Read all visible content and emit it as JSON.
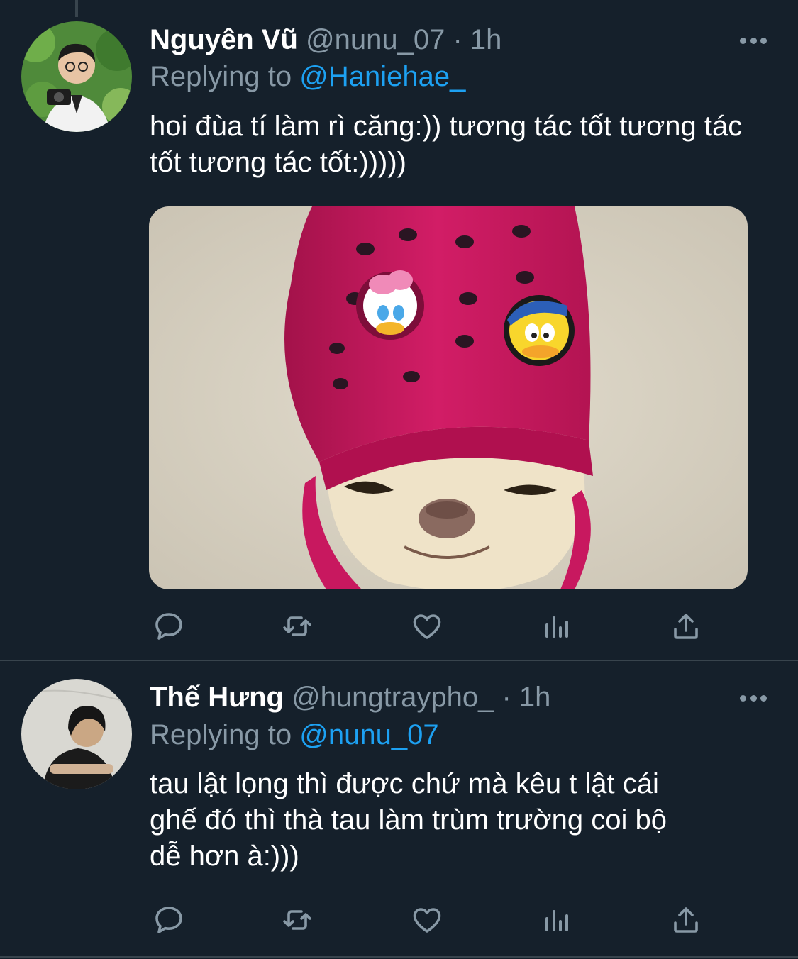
{
  "colors": {
    "background": "#15202b",
    "divider": "#38444d",
    "secondary_text": "#8899a6",
    "link": "#1da1f2",
    "croc_pink": "#c8185f"
  },
  "icons": {
    "more": "more-horizontal-icon",
    "reply": "reply-bubble-icon",
    "retweet": "retweet-icon",
    "like": "heart-icon",
    "analytics": "analytics-bars-icon",
    "share": "share-upload-icon"
  },
  "tweets": [
    {
      "display_name": "Nguyên Vũ",
      "handle": "@nunu_07",
      "time": "· 1h",
      "replying_prefix": "Replying to",
      "replying_handle": "@Haniehae_",
      "text": "hoi đùa tí làm rì căng:)) tương tác tốt tương tác tốt tương tác tốt:)))))",
      "media": "photo of a chihuahua wearing a pink croc shoe as a hat with cartoon duck charms"
    },
    {
      "display_name": "Thế Hưng",
      "handle": "@hungtraypho_",
      "time": "· 1h",
      "replying_prefix": "Replying to",
      "replying_handle": "@nunu_07",
      "text_lines": [
        "tau lật lọng thì được chứ mà kêu t lật cái",
        "ghế đó thì thà tau làm trùm trường coi bộ",
        "dễ hơn à:)))"
      ]
    }
  ]
}
